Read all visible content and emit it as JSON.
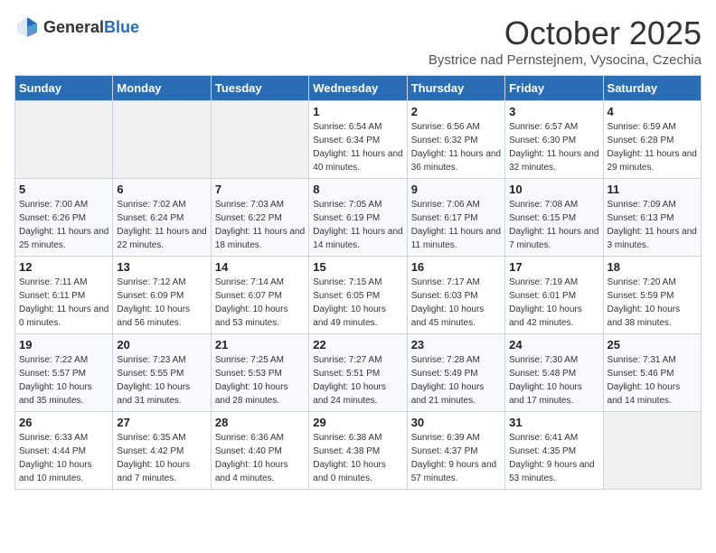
{
  "header": {
    "logo_general": "General",
    "logo_blue": "Blue",
    "month_title": "October 2025",
    "subtitle": "Bystrice nad Pernstejnem, Vysocina, Czechia"
  },
  "weekdays": [
    "Sunday",
    "Monday",
    "Tuesday",
    "Wednesday",
    "Thursday",
    "Friday",
    "Saturday"
  ],
  "weeks": [
    [
      {
        "day": "",
        "empty": true
      },
      {
        "day": "",
        "empty": true
      },
      {
        "day": "",
        "empty": true
      },
      {
        "day": "1",
        "sunrise": "Sunrise: 6:54 AM",
        "sunset": "Sunset: 6:34 PM",
        "daylight": "Daylight: 11 hours and 40 minutes."
      },
      {
        "day": "2",
        "sunrise": "Sunrise: 6:56 AM",
        "sunset": "Sunset: 6:32 PM",
        "daylight": "Daylight: 11 hours and 36 minutes."
      },
      {
        "day": "3",
        "sunrise": "Sunrise: 6:57 AM",
        "sunset": "Sunset: 6:30 PM",
        "daylight": "Daylight: 11 hours and 32 minutes."
      },
      {
        "day": "4",
        "sunrise": "Sunrise: 6:59 AM",
        "sunset": "Sunset: 6:28 PM",
        "daylight": "Daylight: 11 hours and 29 minutes."
      }
    ],
    [
      {
        "day": "5",
        "sunrise": "Sunrise: 7:00 AM",
        "sunset": "Sunset: 6:26 PM",
        "daylight": "Daylight: 11 hours and 25 minutes."
      },
      {
        "day": "6",
        "sunrise": "Sunrise: 7:02 AM",
        "sunset": "Sunset: 6:24 PM",
        "daylight": "Daylight: 11 hours and 22 minutes."
      },
      {
        "day": "7",
        "sunrise": "Sunrise: 7:03 AM",
        "sunset": "Sunset: 6:22 PM",
        "daylight": "Daylight: 11 hours and 18 minutes."
      },
      {
        "day": "8",
        "sunrise": "Sunrise: 7:05 AM",
        "sunset": "Sunset: 6:19 PM",
        "daylight": "Daylight: 11 hours and 14 minutes."
      },
      {
        "day": "9",
        "sunrise": "Sunrise: 7:06 AM",
        "sunset": "Sunset: 6:17 PM",
        "daylight": "Daylight: 11 hours and 11 minutes."
      },
      {
        "day": "10",
        "sunrise": "Sunrise: 7:08 AM",
        "sunset": "Sunset: 6:15 PM",
        "daylight": "Daylight: 11 hours and 7 minutes."
      },
      {
        "day": "11",
        "sunrise": "Sunrise: 7:09 AM",
        "sunset": "Sunset: 6:13 PM",
        "daylight": "Daylight: 11 hours and 3 minutes."
      }
    ],
    [
      {
        "day": "12",
        "sunrise": "Sunrise: 7:11 AM",
        "sunset": "Sunset: 6:11 PM",
        "daylight": "Daylight: 11 hours and 0 minutes."
      },
      {
        "day": "13",
        "sunrise": "Sunrise: 7:12 AM",
        "sunset": "Sunset: 6:09 PM",
        "daylight": "Daylight: 10 hours and 56 minutes."
      },
      {
        "day": "14",
        "sunrise": "Sunrise: 7:14 AM",
        "sunset": "Sunset: 6:07 PM",
        "daylight": "Daylight: 10 hours and 53 minutes."
      },
      {
        "day": "15",
        "sunrise": "Sunrise: 7:15 AM",
        "sunset": "Sunset: 6:05 PM",
        "daylight": "Daylight: 10 hours and 49 minutes."
      },
      {
        "day": "16",
        "sunrise": "Sunrise: 7:17 AM",
        "sunset": "Sunset: 6:03 PM",
        "daylight": "Daylight: 10 hours and 45 minutes."
      },
      {
        "day": "17",
        "sunrise": "Sunrise: 7:19 AM",
        "sunset": "Sunset: 6:01 PM",
        "daylight": "Daylight: 10 hours and 42 minutes."
      },
      {
        "day": "18",
        "sunrise": "Sunrise: 7:20 AM",
        "sunset": "Sunset: 5:59 PM",
        "daylight": "Daylight: 10 hours and 38 minutes."
      }
    ],
    [
      {
        "day": "19",
        "sunrise": "Sunrise: 7:22 AM",
        "sunset": "Sunset: 5:57 PM",
        "daylight": "Daylight: 10 hours and 35 minutes."
      },
      {
        "day": "20",
        "sunrise": "Sunrise: 7:23 AM",
        "sunset": "Sunset: 5:55 PM",
        "daylight": "Daylight: 10 hours and 31 minutes."
      },
      {
        "day": "21",
        "sunrise": "Sunrise: 7:25 AM",
        "sunset": "Sunset: 5:53 PM",
        "daylight": "Daylight: 10 hours and 28 minutes."
      },
      {
        "day": "22",
        "sunrise": "Sunrise: 7:27 AM",
        "sunset": "Sunset: 5:51 PM",
        "daylight": "Daylight: 10 hours and 24 minutes."
      },
      {
        "day": "23",
        "sunrise": "Sunrise: 7:28 AM",
        "sunset": "Sunset: 5:49 PM",
        "daylight": "Daylight: 10 hours and 21 minutes."
      },
      {
        "day": "24",
        "sunrise": "Sunrise: 7:30 AM",
        "sunset": "Sunset: 5:48 PM",
        "daylight": "Daylight: 10 hours and 17 minutes."
      },
      {
        "day": "25",
        "sunrise": "Sunrise: 7:31 AM",
        "sunset": "Sunset: 5:46 PM",
        "daylight": "Daylight: 10 hours and 14 minutes."
      }
    ],
    [
      {
        "day": "26",
        "sunrise": "Sunrise: 6:33 AM",
        "sunset": "Sunset: 4:44 PM",
        "daylight": "Daylight: 10 hours and 10 minutes."
      },
      {
        "day": "27",
        "sunrise": "Sunrise: 6:35 AM",
        "sunset": "Sunset: 4:42 PM",
        "daylight": "Daylight: 10 hours and 7 minutes."
      },
      {
        "day": "28",
        "sunrise": "Sunrise: 6:36 AM",
        "sunset": "Sunset: 4:40 PM",
        "daylight": "Daylight: 10 hours and 4 minutes."
      },
      {
        "day": "29",
        "sunrise": "Sunrise: 6:38 AM",
        "sunset": "Sunset: 4:38 PM",
        "daylight": "Daylight: 10 hours and 0 minutes."
      },
      {
        "day": "30",
        "sunrise": "Sunrise: 6:39 AM",
        "sunset": "Sunset: 4:37 PM",
        "daylight": "Daylight: 9 hours and 57 minutes."
      },
      {
        "day": "31",
        "sunrise": "Sunrise: 6:41 AM",
        "sunset": "Sunset: 4:35 PM",
        "daylight": "Daylight: 9 hours and 53 minutes."
      },
      {
        "day": "",
        "empty": true
      }
    ]
  ]
}
